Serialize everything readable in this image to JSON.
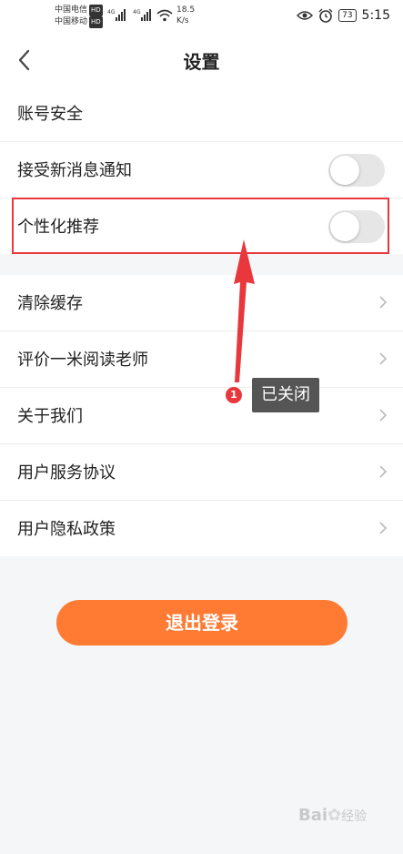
{
  "status_bar": {
    "carrier1": "中国电信",
    "carrier2": "中国移动",
    "hd": "HD",
    "net": "4G",
    "speed_value": "18.5",
    "speed_unit": "K/s",
    "battery": "73",
    "time": "5:15"
  },
  "header": {
    "title": "设置"
  },
  "settings": {
    "account_security": "账号安全",
    "new_message_notify": {
      "label": "接受新消息通知",
      "enabled": false
    },
    "personalized": {
      "label": "个性化推荐",
      "enabled": false
    }
  },
  "menu": {
    "clear_cache": "清除缓存",
    "rate_teacher": "评价一米阅读老师",
    "about_us": "关于我们",
    "service_agreement": "用户服务协议",
    "privacy_policy": "用户隐私政策"
  },
  "annotation": {
    "badge": "1",
    "text": "已关闭",
    "color": "#e8383d"
  },
  "logout_button": {
    "label": "退出登录",
    "color": "#ff7a33"
  },
  "watermark": {
    "brand": "Bai",
    "brand2": "经验"
  }
}
